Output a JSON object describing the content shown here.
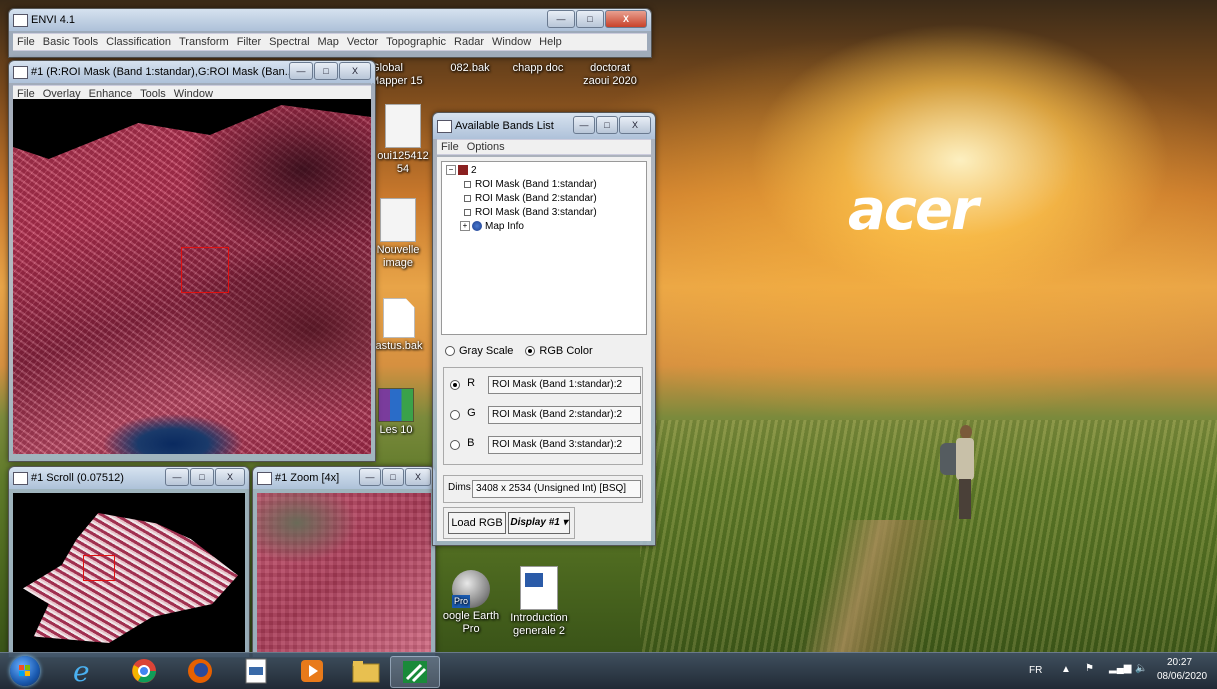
{
  "envi_main": {
    "title": "ENVI 4.1",
    "menu": [
      "File",
      "Basic Tools",
      "Classification",
      "Transform",
      "Filter",
      "Spectral",
      "Map",
      "Vector",
      "Topographic",
      "Radar",
      "Window",
      "Help"
    ],
    "min": "—",
    "max": "□",
    "close": "X"
  },
  "image_window": {
    "title": "#1 (R:ROI Mask (Band 1:standar),G:ROI Mask (Ban...",
    "menu": [
      "File",
      "Overlay",
      "Enhance",
      "Tools",
      "Window"
    ]
  },
  "scroll_window": {
    "title": "#1 Scroll (0.07512)"
  },
  "zoom_window": {
    "title": "#1 Zoom [4x]"
  },
  "bands_list": {
    "title": "Available Bands List",
    "menu": [
      "File",
      "Options"
    ],
    "tree": {
      "root": "2",
      "bands": [
        "ROI Mask (Band 1:standar)",
        "ROI Mask (Band 2:standar)",
        "ROI Mask (Band 3:standar)"
      ],
      "map_info": "Map Info"
    },
    "mode_gray": "Gray Scale",
    "mode_rgb": "RGB Color",
    "r_label": "R",
    "r_value": "ROI Mask (Band 1:standar):2",
    "g_label": "G",
    "g_value": "ROI Mask (Band 2:standar):2",
    "b_label": "B",
    "b_value": "ROI Mask (Band 3:standar):2",
    "dims_label": "Dims",
    "dims_value": "3408 x 2534 (Unsigned Int) [BSQ]",
    "load_button": "Load RGB",
    "display_button": "Display #1 ▾"
  },
  "desktop": {
    "brand": "acer",
    "icons": [
      {
        "label": "Global\nMapper 15"
      },
      {
        "label": "082.bak"
      },
      {
        "label": "chapp doc"
      },
      {
        "label": "doctorat\nzaoui 2020"
      },
      {
        "label": "oui125412\n54"
      },
      {
        "label": "Nouvelle\nimage"
      },
      {
        "label": "astus.bak"
      },
      {
        "label": "Les 10"
      },
      {
        "label": "oogle Earth\nPro"
      },
      {
        "label": "Introduction\ngenerale 2"
      }
    ]
  },
  "taskbar": {
    "lang": "FR",
    "time": "20:27",
    "date": "08/06/2020",
    "apps": [
      "internet-explorer",
      "chrome",
      "firefox",
      "notepad",
      "media-player",
      "file-explorer",
      "envi"
    ]
  }
}
